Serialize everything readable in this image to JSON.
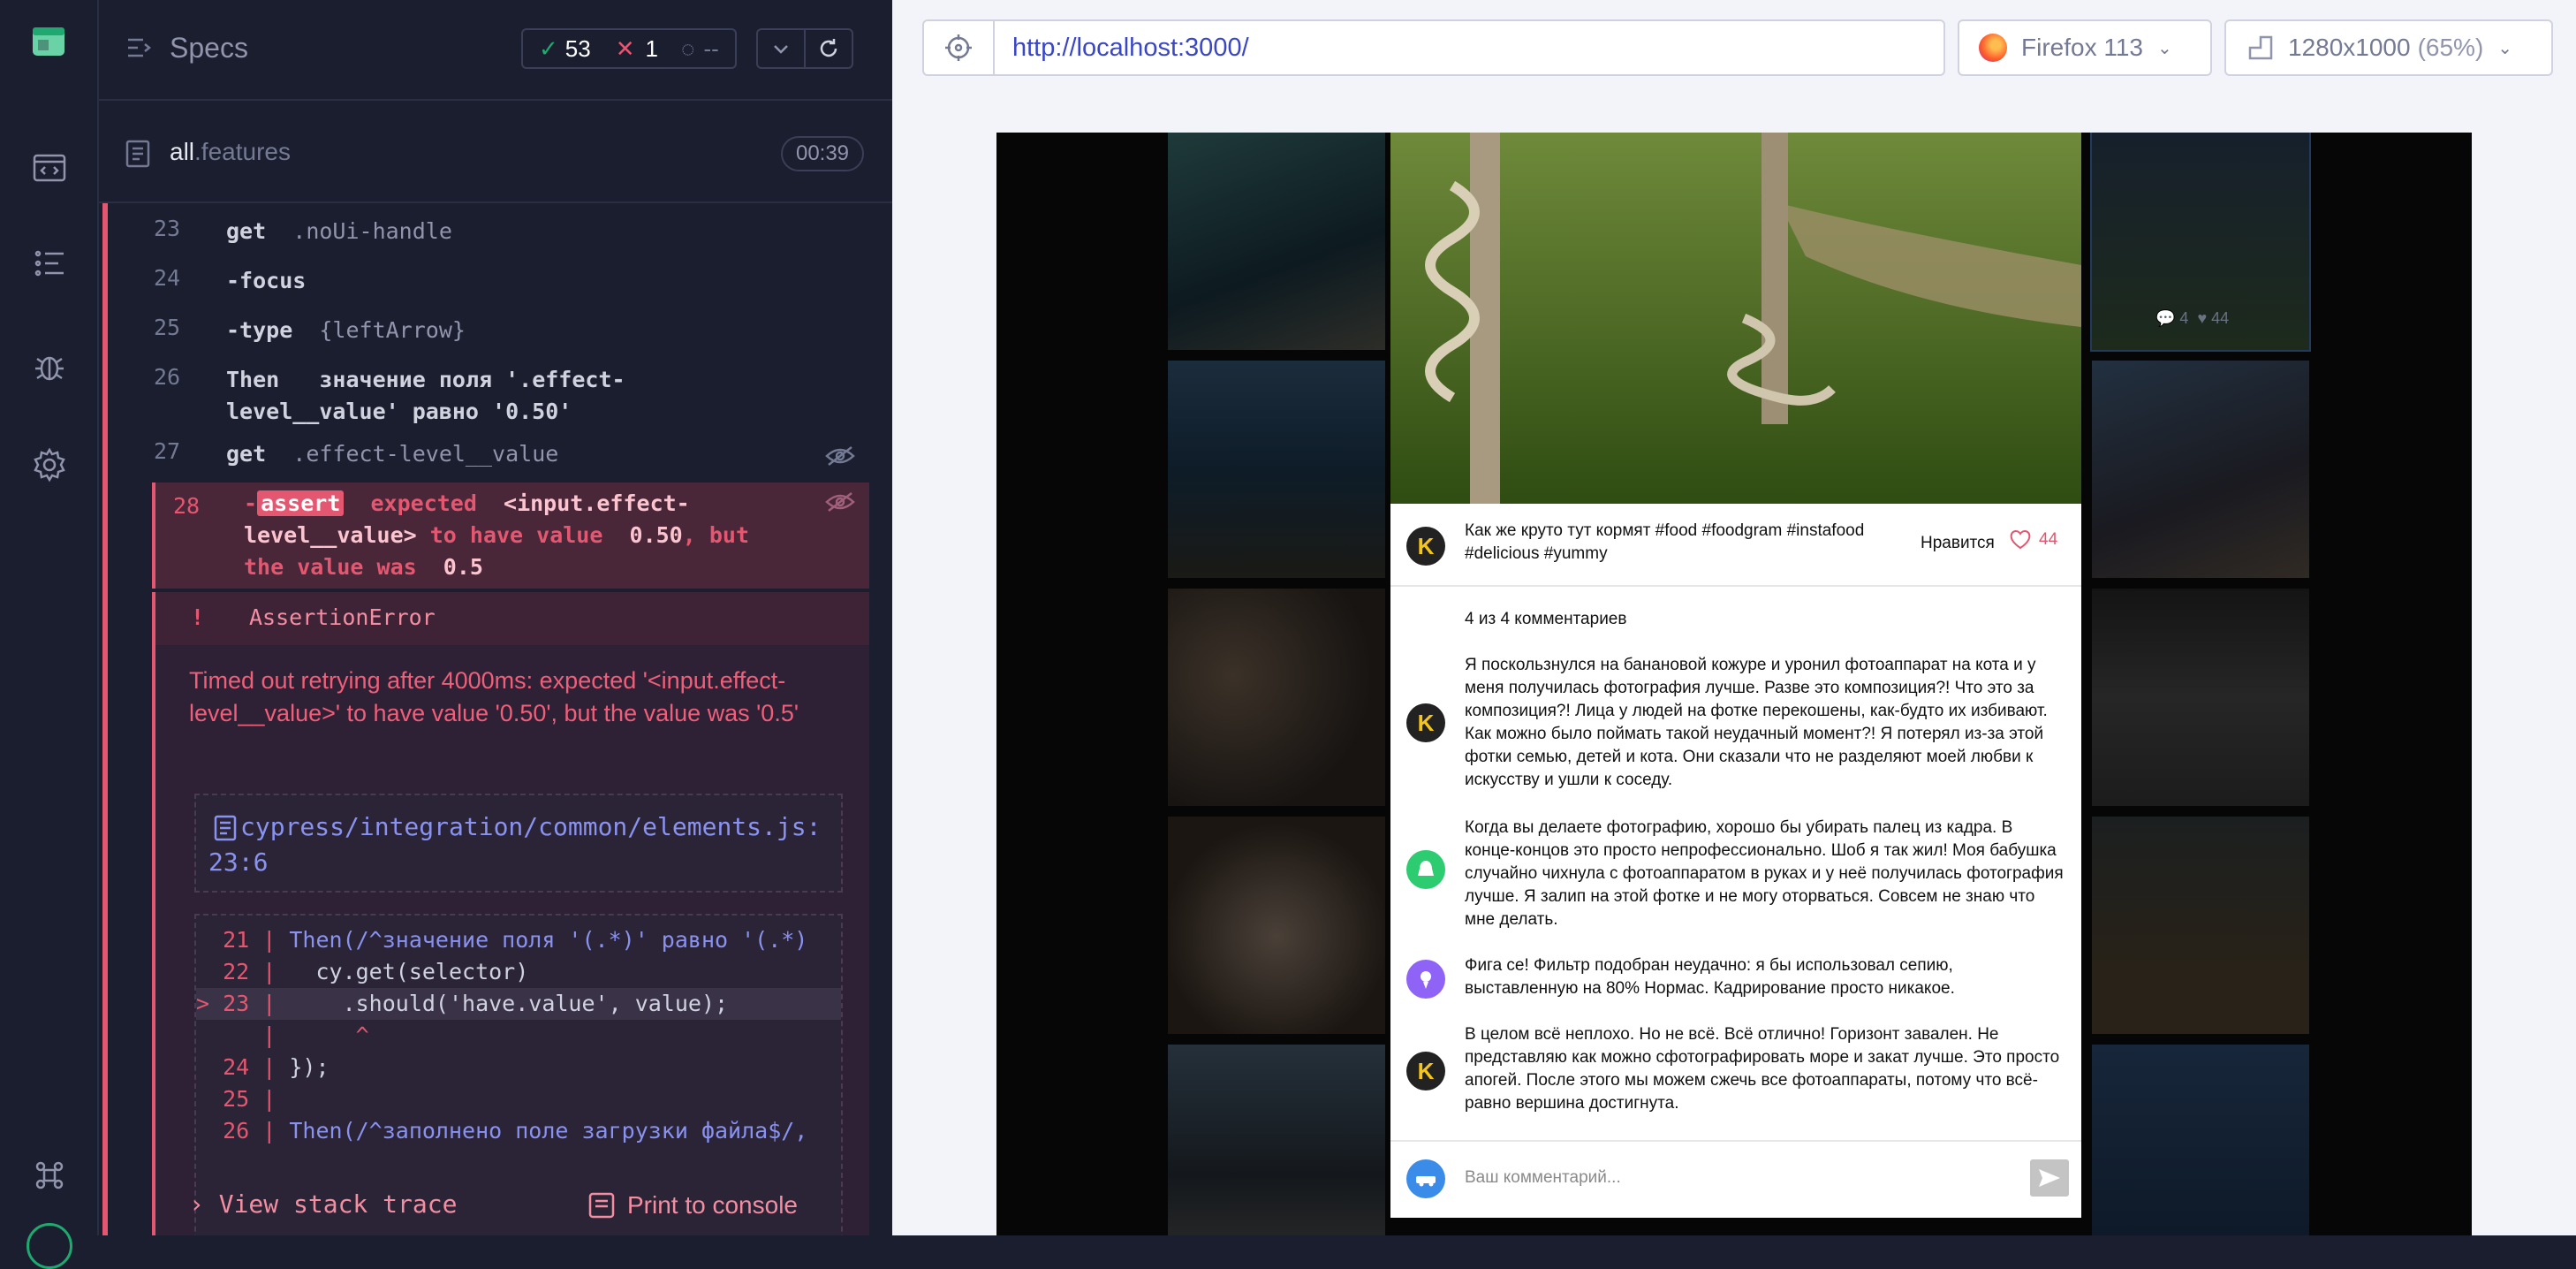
{
  "nav": {
    "icons": [
      "cypress-logo-icon",
      "specs-icon",
      "runs-icon",
      "debug-icon",
      "settings-icon",
      "keyboard-shortcuts-icon"
    ]
  },
  "header": {
    "title": "Specs",
    "passed": "53",
    "failed": "1",
    "pending": "--"
  },
  "spec": {
    "name": "all",
    "ext": ".features",
    "duration": "00:39"
  },
  "commands": [
    {
      "num": "23",
      "name": "get",
      "message": ".noUi-handle"
    },
    {
      "num": "24",
      "name": "-focus",
      "message": ""
    },
    {
      "num": "25",
      "name": "-type",
      "message": "{leftArrow}"
    },
    {
      "num": "26",
      "name": "Then",
      "message": "значение поля '.effect-level__value' равно '0.50'"
    },
    {
      "num": "27",
      "name": "get",
      "message": ".effect-level__value"
    }
  ],
  "failed_command": {
    "num": "28",
    "prefix": "-",
    "name": "assert",
    "p1": "expected",
    "p2": "<input.effect-level__value>",
    "p3": "to have value",
    "p4": "0.50",
    "p5": ", but the value was",
    "p6": "0.5"
  },
  "error": {
    "bang": "!",
    "type": "AssertionError",
    "message": "Timed out retrying after 4000ms: expected '<input.effect-level__value>' to have value '0.50', but the value was '0.5'",
    "file": "cypress/integration/common/elements.js:23:6",
    "stack_label": "View stack trace",
    "print_label": "Print to console"
  },
  "code_lines": [
    {
      "gutter": "  21 | ",
      "text": "Then(/^значение поля '(.*)' равно '(.*)"
    },
    {
      "gutter": "  22 | ",
      "text": "  cy.get(selector)"
    },
    {
      "gutter": "> 23 | ",
      "text": "    .should('have.value', value);"
    },
    {
      "gutter": "     | ",
      "text": "     ^"
    },
    {
      "gutter": "  24 | ",
      "text": "});"
    },
    {
      "gutter": "  25 | ",
      "text": ""
    },
    {
      "gutter": "  26 | ",
      "text": "Then(/^заполнено поле загрузки файла$/,"
    }
  ],
  "browser_bar": {
    "url": "http://localhost:3000/",
    "browser": "Firefox 113",
    "viewport": "1280x1000",
    "scale": "(65%)"
  },
  "app": {
    "thumb_comments": "4",
    "thumb_likes": "44",
    "post_avatar": "K",
    "caption": "Как же круто тут кормят #food #foodgram #instafood #delicious #yummy",
    "like_label": "Нравится",
    "likes": "44",
    "comments_count": "4 из 4 комментариев",
    "comments": [
      {
        "avatar": "K",
        "color": "#222222",
        "text": "Я поскользнулся на банановой кожуре и уронил фотоаппарат на кота и у меня получилась фотография лучше. Разве это композиция?! Что это за композиция?! Лица у людей на фотке перекошены, как-будто их избивают. Как можно было поймать такой неудачный момент?! Я потерял из-за этой фотки семью, детей и кота. Они сказали что не разделяют моей любви к искусству и ушли к соседу."
      },
      {
        "avatar": "",
        "color": "#2dcc70",
        "text": "Когда вы делаете фотографию, хорошо бы убирать палец из кадра. В конце-концов это просто непрофессионально. Шоб я так жил! Моя бабушка случайно чихнула с фотоаппаратом в руках и у неё получилась фотография лучше. Я залип на этой фотке и не могу оторваться. Совсем не знаю что мне делать."
      },
      {
        "avatar": "",
        "color": "#8e63f5",
        "text": "Фига се! Фильтр подобран неудачно: я бы использовал сепию, выставленную на 80% Нормас. Кадрирование просто никакое."
      },
      {
        "avatar": "K",
        "color": "#222222",
        "text": "В целом всё неплохо. Но не всё. Всё отлично! Горизонт завален. Не представляю как можно сфотографировать море и закат лучше. Это просто апогей. После этого мы можем сжечь все фотоаппараты, потому что всё-равно вершина достигнута."
      }
    ],
    "comment_placeholder": "Ваш комментарий..."
  },
  "colors": {
    "accent_red": "#e45770",
    "pass_green": "#1fa971",
    "link_blue": "#3a47c4",
    "likes_red": "#e2566f"
  }
}
